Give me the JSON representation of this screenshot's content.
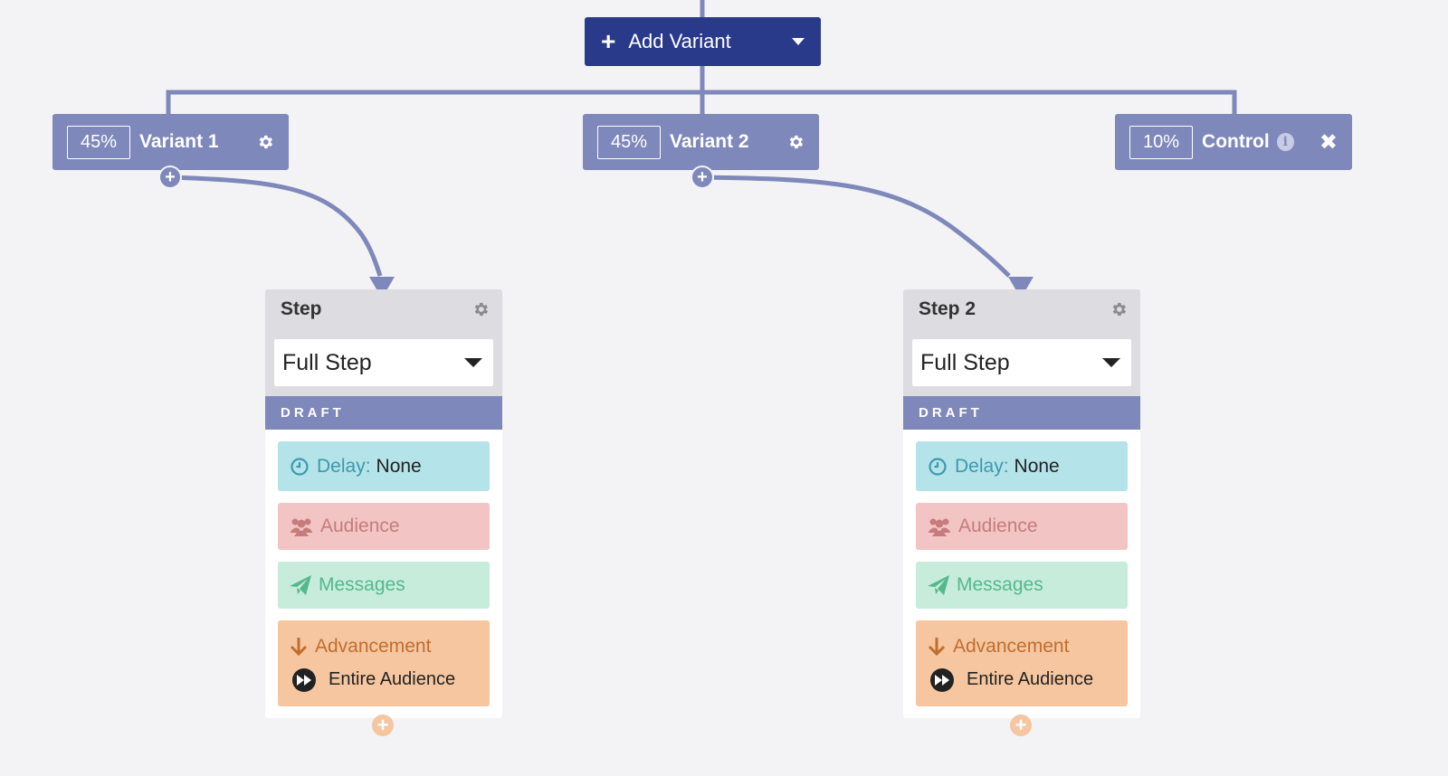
{
  "toolbar": {
    "add_variant_label": "Add Variant"
  },
  "variants": [
    {
      "percent": "45%",
      "name": "Variant 1"
    },
    {
      "percent": "45%",
      "name": "Variant 2"
    },
    {
      "percent": "10%",
      "name": "Control"
    }
  ],
  "steps": [
    {
      "title": "Step",
      "type": "Full Step",
      "status": "DRAFT",
      "delay_label": "Delay:",
      "delay_value": "None",
      "audience_label": "Audience",
      "messages_label": "Messages",
      "advancement_label": "Advancement",
      "advancement_value": "Entire Audience"
    },
    {
      "title": "Step 2",
      "type": "Full Step",
      "status": "DRAFT",
      "delay_label": "Delay:",
      "delay_value": "None",
      "audience_label": "Audience",
      "messages_label": "Messages",
      "advancement_label": "Advancement",
      "advancement_value": "Entire Audience"
    }
  ],
  "colors": {
    "primary_button": "#2a3a8a",
    "variant": "#7f88ba",
    "delay": "#b5e3ea",
    "audience": "#f2c4c4",
    "messages": "#c8ecdc",
    "advancement": "#f5c6a0"
  }
}
